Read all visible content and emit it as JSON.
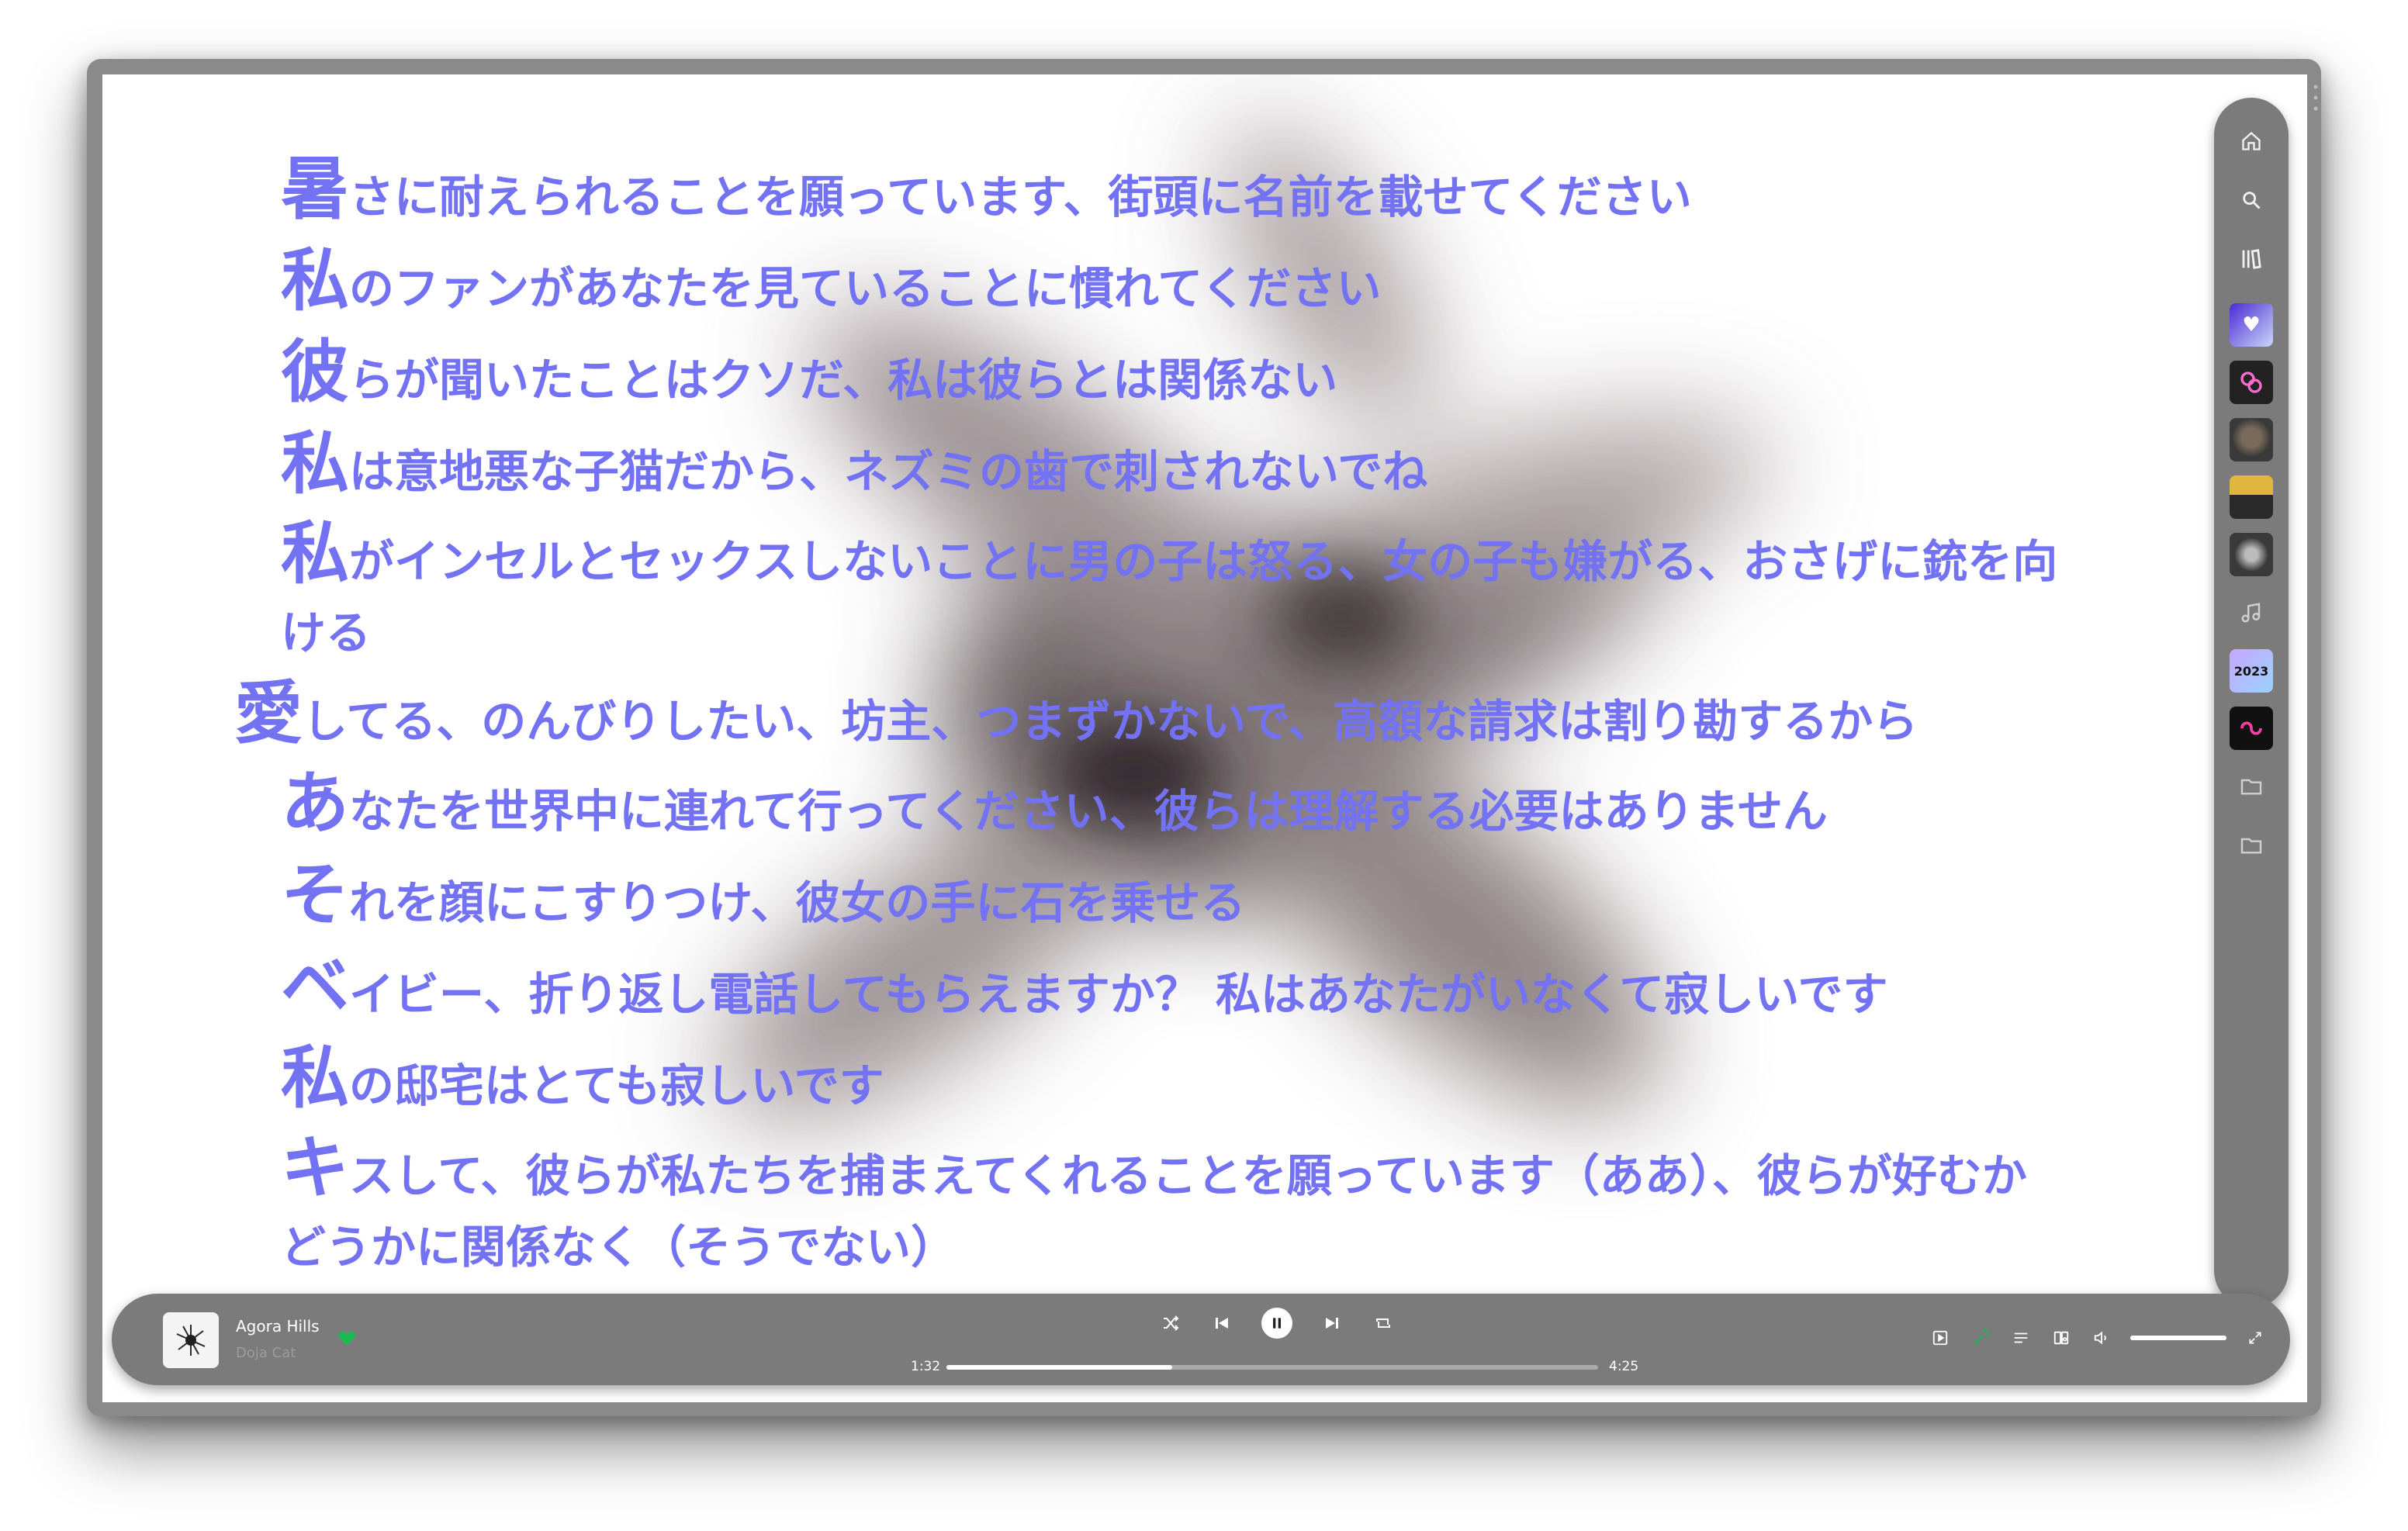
{
  "lyrics": {
    "lines": [
      {
        "first": "暑",
        "rest": "さに耐えられることを願っています、街頭に名前を載せてください"
      },
      {
        "first": "私",
        "rest": "のファンがあなたを見ていることに慣れてください"
      },
      {
        "first": "彼",
        "rest": "らが聞いたことはクソだ、私は彼らとは関係ない"
      },
      {
        "first": "私",
        "rest": "は意地悪な子猫だから、ネズミの歯で刺されないでね"
      },
      {
        "first": "私",
        "rest": "がインセルとセックスしないことに男の子は怒る、女の子も嫌がる、おさげに銃を向ける"
      },
      {
        "first": "愛",
        "rest": "してる、のんびりしたい、坊主、つまずかないで、高額な請求は割り勘するから"
      },
      {
        "first": "あ",
        "rest": "なたを世界中に連れて行ってください、彼らは理解する必要はありません"
      },
      {
        "first": "そ",
        "rest": "れを顔にこすりつけ、彼女の手に石を乗せる"
      },
      {
        "first": "ベ",
        "rest": "イビー、折り返し電話してもらえますか？ 私はあなたがいなくて寂しいです"
      },
      {
        "first": "私",
        "rest": "の邸宅はとても寂しいです"
      },
      {
        "first": "キ",
        "rest": "スして、彼らが私たちを捕まえてくれることを願っています（ああ）、彼らが好むかどうかに関係なく（そうでない）"
      }
    ],
    "color": "#7272f2"
  },
  "sidebar": {
    "home_icon": "home-icon",
    "search_icon": "search-icon",
    "library_icon": "library-icon",
    "tiles": [
      {
        "name": "liked-songs",
        "icon": "heart-icon"
      },
      {
        "name": "on-repeat",
        "icon": "playlist-tile"
      },
      {
        "name": "playlist-photo-1",
        "icon": "playlist-tile"
      },
      {
        "name": "playlist-photo-2",
        "icon": "playlist-tile"
      },
      {
        "name": "playlist-photo-3",
        "icon": "playlist-tile"
      },
      {
        "name": "music-note",
        "icon": "music-note-icon"
      },
      {
        "name": "playlist-2023",
        "label": "2023"
      },
      {
        "name": "smooth-sound",
        "icon": "playlist-tile"
      },
      {
        "name": "folder-1",
        "icon": "folder-icon"
      },
      {
        "name": "folder-2",
        "icon": "folder-icon"
      }
    ]
  },
  "player": {
    "title": "Agora Hills",
    "artist": "Doja Cat",
    "elapsed": "1:32",
    "duration": "4:25",
    "progress_fraction": 0.347,
    "volume_fraction": 1.0,
    "accent": "#1db954"
  }
}
